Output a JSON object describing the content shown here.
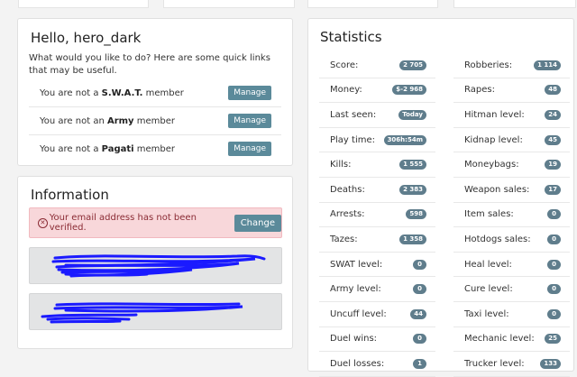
{
  "hello": {
    "title": "Hello, hero_dark",
    "intro": "What would you like to do? Here are some quick links that may be useful.",
    "memberships": [
      {
        "prefix": "You are not a ",
        "org": "S.W.A.T.",
        "suffix": " member",
        "button": "Manage"
      },
      {
        "prefix": "You are not an ",
        "org": "Army",
        "suffix": " member",
        "button": "Manage"
      },
      {
        "prefix": "You are not a ",
        "org": "Pagati",
        "suffix": " member",
        "button": "Manage"
      }
    ]
  },
  "information": {
    "title": "Information",
    "alert_text": "Your email address has not been verified.",
    "alert_button": "Change"
  },
  "statistics": {
    "title": "Statistics",
    "left": [
      {
        "label": "Score:",
        "value": "2 705"
      },
      {
        "label": "Money:",
        "value": "$-2 968"
      },
      {
        "label": "Last seen:",
        "value": "Today"
      },
      {
        "label": "Play time:",
        "value": "306h:54m"
      },
      {
        "label": "Kills:",
        "value": "1 555"
      },
      {
        "label": "Deaths:",
        "value": "2 383"
      },
      {
        "label": "Arrests:",
        "value": "598"
      },
      {
        "label": "Tazes:",
        "value": "1 358"
      },
      {
        "label": "SWAT level:",
        "value": "0"
      },
      {
        "label": "Army level:",
        "value": "0"
      },
      {
        "label": "Uncuff level:",
        "value": "44"
      },
      {
        "label": "Duel wins:",
        "value": "0"
      },
      {
        "label": "Duel losses:",
        "value": "1"
      }
    ],
    "right": [
      {
        "label": "Robberies:",
        "value": "1 114"
      },
      {
        "label": "Rapes:",
        "value": "48"
      },
      {
        "label": "Hitman level:",
        "value": "24"
      },
      {
        "label": "Kidnap level:",
        "value": "45"
      },
      {
        "label": "Moneybags:",
        "value": "19"
      },
      {
        "label": "Weapon sales:",
        "value": "17"
      },
      {
        "label": "Item sales:",
        "value": "0"
      },
      {
        "label": "Hotdogs sales:",
        "value": "0"
      },
      {
        "label": "Heal level:",
        "value": "0"
      },
      {
        "label": "Cure level:",
        "value": "0"
      },
      {
        "label": "Taxi level:",
        "value": "0"
      },
      {
        "label": "Mechanic level:",
        "value": "25"
      },
      {
        "label": "Trucker level:",
        "value": "133"
      }
    ]
  },
  "colors": {
    "button": "#5b8a9a",
    "badge": "#5f7d8c",
    "alert_bg": "#f8d7da",
    "scribble": "#1a1aff"
  }
}
